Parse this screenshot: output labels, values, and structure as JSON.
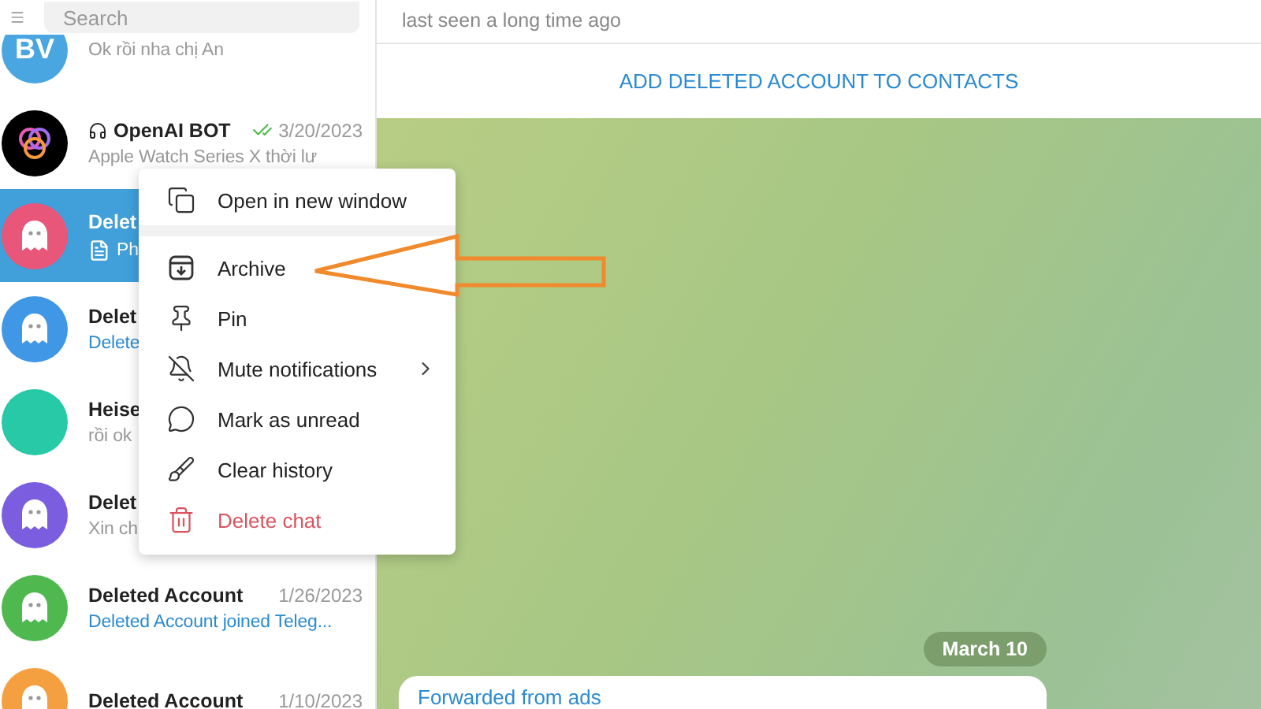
{
  "sidebar": {
    "search": {
      "placeholder": "Search"
    },
    "chats": [
      {
        "avatar": {
          "kind": "initials",
          "text": "BV",
          "color": "#4aa6e0"
        },
        "preview": "Ok rồi nha chị An",
        "kind": "plain",
        "selected": false
      },
      {
        "avatar": {
          "kind": "logo",
          "color": "#000000"
        },
        "title": "OpenAI BOT",
        "bot": true,
        "read": true,
        "date": "3/20/2023",
        "preview": "Apple Watch Series X thời lư",
        "kind": "plain",
        "selected": false
      },
      {
        "avatar": {
          "kind": "ghost",
          "color": "#e8567a"
        },
        "title": "Delet",
        "preview": "Ph",
        "kind": "document",
        "selected": true
      },
      {
        "avatar": {
          "kind": "ghost",
          "color": "#3f97e6"
        },
        "title": "Delet",
        "preview": "Delete",
        "kind": "link",
        "selected": false
      },
      {
        "avatar": {
          "kind": "photo",
          "color": "#27c9a6"
        },
        "title": "Heise",
        "preview": "rồi ok",
        "kind": "plain",
        "selected": false
      },
      {
        "avatar": {
          "kind": "ghost",
          "color": "#7b5ee0"
        },
        "title": "Delet",
        "preview": "Xin ch",
        "kind": "plain",
        "selected": false
      },
      {
        "avatar": {
          "kind": "ghost",
          "color": "#4fb950"
        },
        "title": "Deleted Account",
        "date": "1/26/2023",
        "preview": "Deleted Account joined Teleg...",
        "kind": "link",
        "selected": false
      },
      {
        "avatar": {
          "kind": "ghost",
          "color": "#f5a040"
        },
        "title": "Deleted Account",
        "date": "1/10/2023",
        "kind": "plain",
        "selected": false
      }
    ]
  },
  "chat": {
    "status": "last seen a long time ago",
    "action": "ADD DELETED ACCOUNT TO CONTACTS",
    "date_pill": "March 10",
    "messages": [
      {
        "forwarded": "Forwarded from ads"
      }
    ]
  },
  "context_menu": {
    "items": [
      {
        "label": "Open in new window",
        "kind": "normal",
        "separator_after": true
      },
      {
        "label": "Archive",
        "kind": "normal",
        "separator_after": false
      },
      {
        "label": "Pin",
        "kind": "normal",
        "separator_after": false
      },
      {
        "label": "Mute notifications",
        "kind": "submenu",
        "separator_after": false
      },
      {
        "label": "Mark as unread",
        "kind": "normal",
        "separator_after": false
      },
      {
        "label": "Clear history",
        "kind": "normal",
        "separator_after": false
      },
      {
        "label": "Delete chat",
        "kind": "danger",
        "separator_after": false
      }
    ]
  }
}
